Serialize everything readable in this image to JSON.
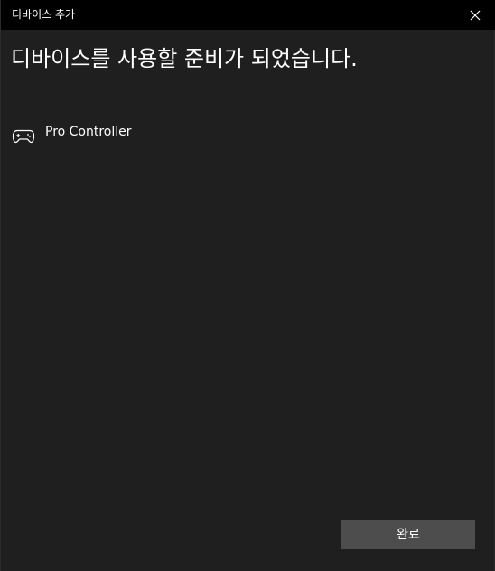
{
  "window": {
    "title": "디바이스 추가"
  },
  "main": {
    "heading": "디바이스를 사용할 준비가 되었습니다."
  },
  "devices": [
    {
      "name": "Pro Controller",
      "icon": "gamepad-icon"
    }
  ],
  "footer": {
    "done_label": "완료"
  },
  "colors": {
    "titlebar_bg": "#000000",
    "window_bg": "#1f1f1f",
    "button_bg": "#4d4d4d",
    "text": "#ffffff"
  }
}
